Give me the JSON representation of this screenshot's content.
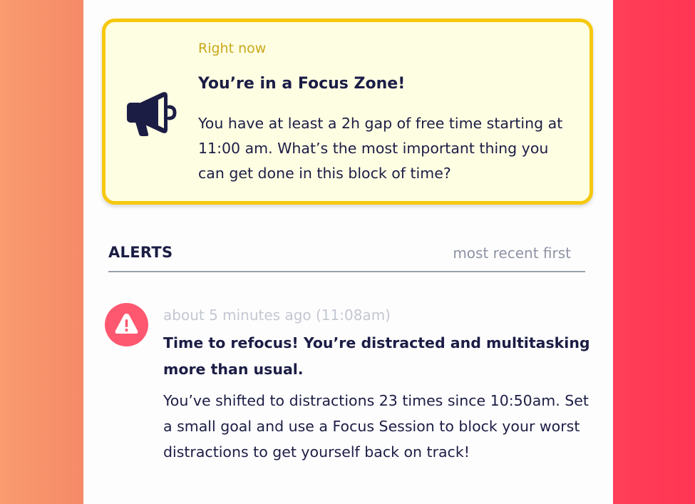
{
  "focus_card": {
    "kicker": "Right now",
    "title": "You’re in a Focus Zone!",
    "body": "You have at least a 2h gap of free time starting at 11:00 am. What’s the most important thing you can get done in this block of time?",
    "icon": "megaphone-icon",
    "colors": {
      "border": "#f6c80e",
      "background": "#fefee3",
      "kicker": "#c8a81a"
    }
  },
  "alerts": {
    "heading": "ALERTS",
    "sort_label": "most recent first",
    "items": [
      {
        "icon": "warning-icon",
        "time": "about 5 minutes ago (11:08am)",
        "title": "Time to refocus! You’re distracted and multitasking more than usual.",
        "body": "You’ve shifted to distractions 23 times since 10:50am. Set a small goal and use a Focus Session to block your worst distractions to get yourself back on track!",
        "badge_color": "#fd5870"
      }
    ]
  },
  "colors": {
    "text": "#1c1d45",
    "bg_left": "#f99b6f",
    "bg_right": "#ff3f58"
  }
}
